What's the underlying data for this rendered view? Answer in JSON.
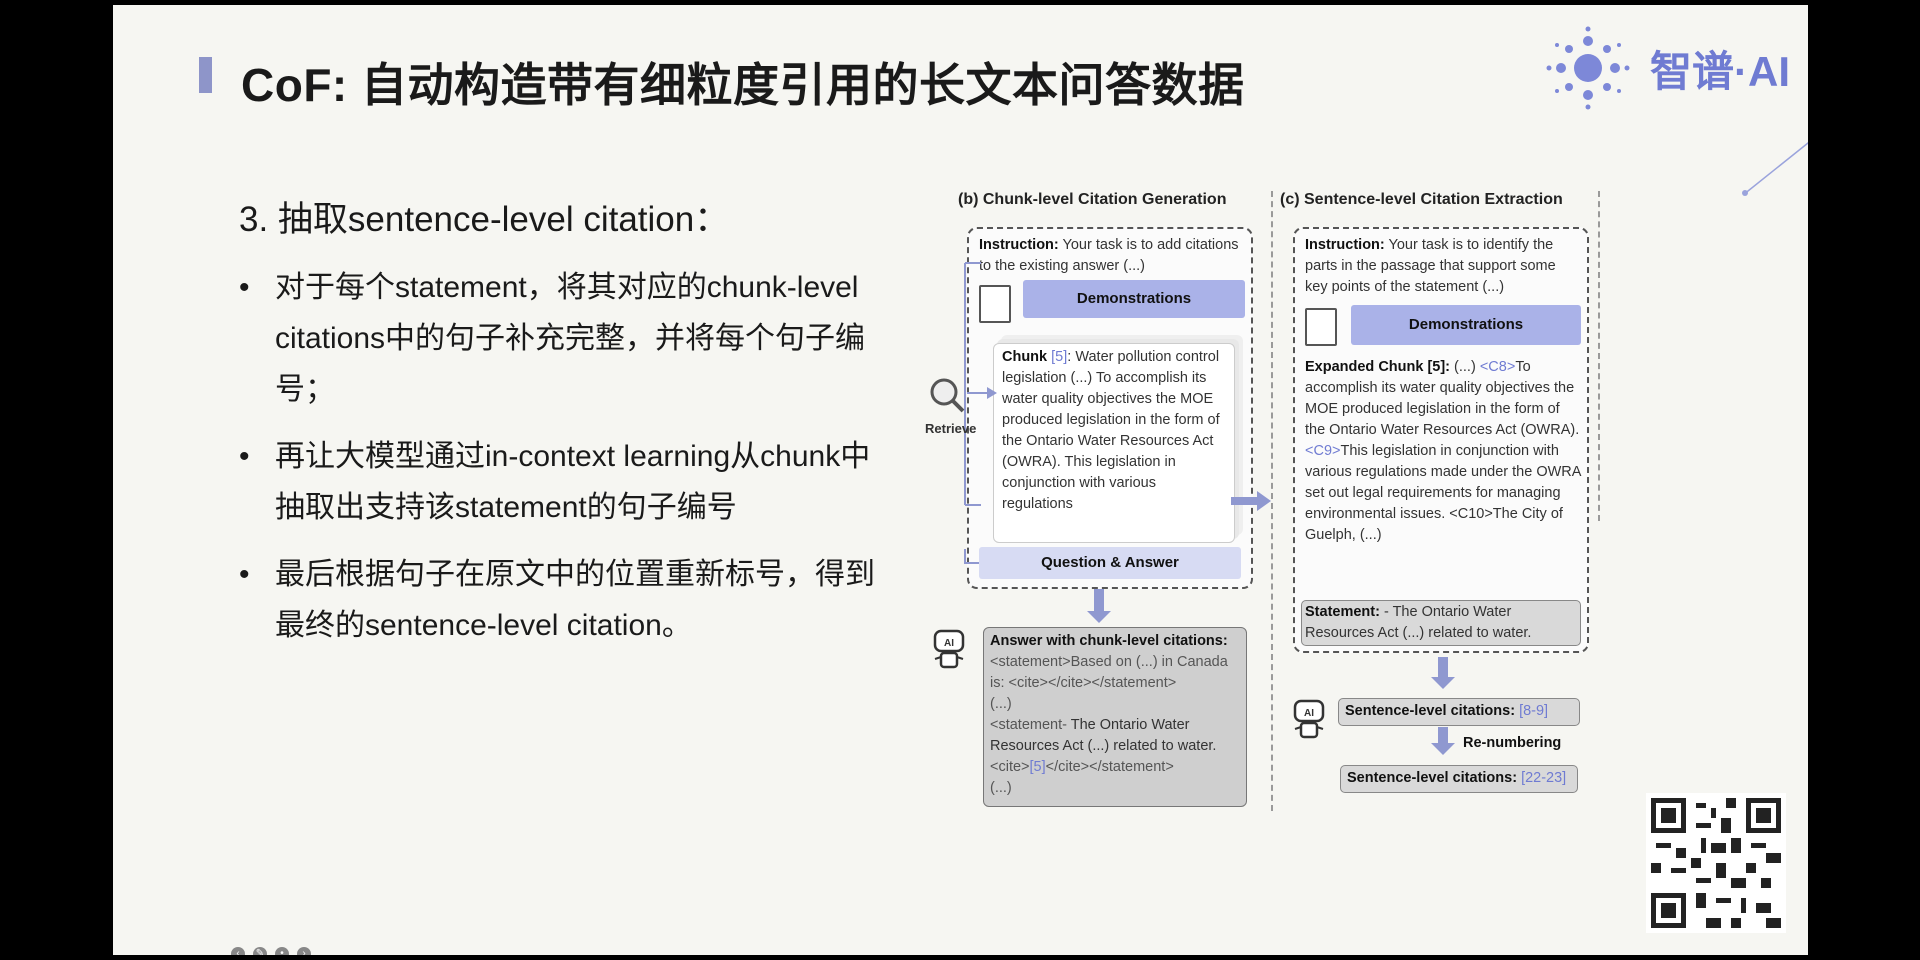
{
  "slide": {
    "title": "CoF: 自动构造带有细粒度引用的长文本问答数据",
    "logo_text": "智谱·AI"
  },
  "left": {
    "heading": "3. 抽取sentence-level citation：",
    "bullets": [
      "对于每个statement，将其对应的chunk-level citations中的句子补充完整，并将每个句子编号；",
      "再让大模型通过in-context learning从chunk中抽取出支持该statement的句子编号",
      "最后根据句子在原文中的位置重新标号，得到最终的sentence-level citation。"
    ]
  },
  "panel_b": {
    "title": "(b) Chunk-level Citation Generation",
    "instruction_label": "Instruction:",
    "instruction_text": "Your task is to add citations to the existing answer (...)",
    "demonstrations": "Demonstrations",
    "retrieve": "Retrieve",
    "chunk_label": "Chunk",
    "chunk_cite": "[5]",
    "chunk_text": ": Water pollution control legislation (...) To accomplish its water quality objectives the MOE produced legislation in the form of the Ontario Water Resources Act (OWRA). This legislation in conjunction with various regulations",
    "qa": "Question & Answer",
    "answer_label": "Answer with chunk-level citations:",
    "answer_line1": "<statement>Based on (...) in Canada is: <cite></cite></statement>",
    "answer_line2": "(...)",
    "answer_line3_a": "<statement-",
    "answer_line3_b": " The Ontario Water Resources Act (...) related to water.",
    "answer_line3_c": "<cite>",
    "answer_line3_cite": "[5]",
    "answer_line3_d": "</cite></statement>",
    "answer_line4": "(...)"
  },
  "panel_c": {
    "title": "(c) Sentence-level Citation Extraction",
    "instruction_label": "Instruction:",
    "instruction_text": "Your task is to identify the parts in the passage that support some key points of the statement (...)",
    "demonstrations": "Demonstrations",
    "expanded_label": "Expanded Chunk [5]:",
    "expanded_pre": "(...)",
    "c8": "<C8>",
    "expanded_text1": "To accomplish its water quality objectives the MOE produced legislation in the form of the Ontario Water Resources Act (OWRA).",
    "c9": "<C9>",
    "expanded_text2": "This legislation in conjunction with various regulations made under the OWRA set out legal requirements for managing environmental issues. <C10>The City of Guelph, (...)",
    "statement_label": "Statement:",
    "statement_text": "- The Ontario Water Resources Act (...) related to water.",
    "slc1_label": "Sentence-level citations:",
    "slc1_value": "[8-9]",
    "renumbering": "Re-numbering",
    "slc2_label": "Sentence-level citations:",
    "slc2_value": "[22-23]"
  },
  "colors": {
    "accent": "#8e95c9",
    "demo_blue": "#aab2e8",
    "cite_blue": "#6f7bd2"
  }
}
